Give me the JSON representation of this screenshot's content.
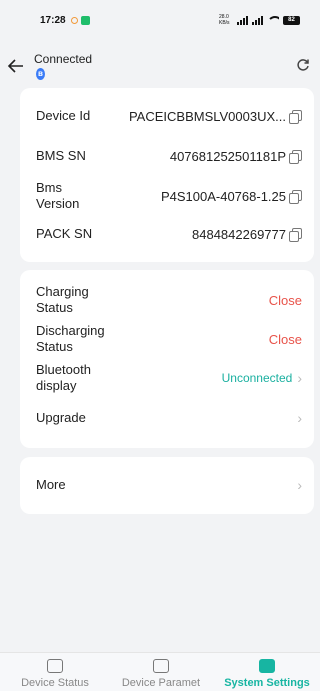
{
  "status_bar": {
    "time": "17:28",
    "network_speed": "28.0 KB/s",
    "signal1": "5G",
    "signal2": "5G",
    "battery": "82"
  },
  "header": {
    "connection_status": "Connected"
  },
  "device_info": {
    "rows": [
      {
        "label": "Device Id",
        "value": "PACEICBBMSLV0003UX..."
      },
      {
        "label": "BMS SN",
        "value": "407681252501181P"
      },
      {
        "label": "Bms Version",
        "value": "P4S100A-40768-1.25"
      },
      {
        "label": "PACK SN",
        "value": "8484842269777"
      }
    ]
  },
  "settings": {
    "charging_label": "Charging Status",
    "charging_value": "Close",
    "discharging_label": "Discharging Status",
    "discharging_value": "Close",
    "bluetooth_label": "Bluetooth display",
    "bluetooth_value": "Unconnected",
    "upgrade_label": "Upgrade"
  },
  "more": {
    "label": "More"
  },
  "tabs": [
    {
      "label": "Device Status",
      "icon": "storage-icon",
      "active": false
    },
    {
      "label": "Device Paramet",
      "icon": "chart-icon",
      "active": false
    },
    {
      "label": "System Settings",
      "icon": "settings-icon",
      "active": true
    }
  ],
  "colors": {
    "accent": "#17b5a2",
    "danger": "#e8534a",
    "bluetooth": "#3a7bf7"
  }
}
